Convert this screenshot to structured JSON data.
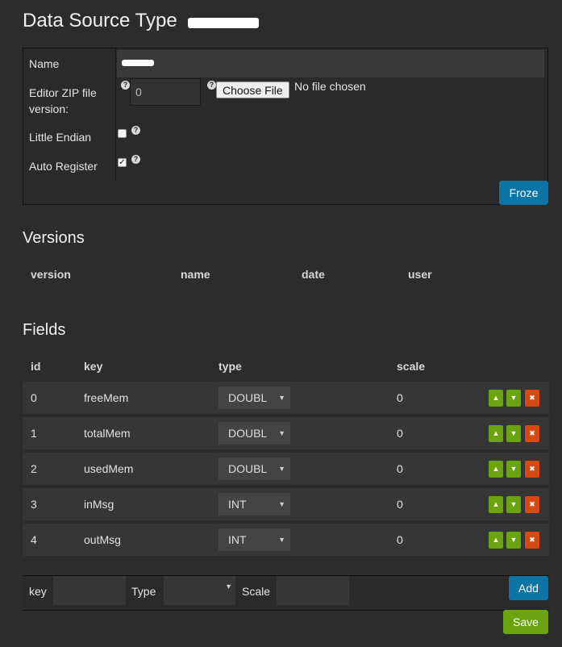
{
  "page": {
    "title": "Data Source Type"
  },
  "settings": {
    "name_label": "Name",
    "editor_zip_label_line1": "Editor ZIP file",
    "editor_zip_label_line2": "version:",
    "editor_zip_value": "0",
    "choose_file_label": "Choose File",
    "no_file_text": "No file chosen",
    "little_endian_label": "Little Endian",
    "little_endian_checked": false,
    "auto_register_label": "Auto Register",
    "auto_register_checked": true,
    "help_glyph": "?",
    "froze_label": "Froze"
  },
  "versions": {
    "heading": "Versions",
    "columns": [
      "version",
      "name",
      "date",
      "user"
    ]
  },
  "fields": {
    "heading": "Fields",
    "columns": [
      "id",
      "key",
      "type",
      "scale"
    ],
    "rows": [
      {
        "id": "0",
        "key": "freeMem",
        "type": "DOUBL",
        "scale": "0"
      },
      {
        "id": "1",
        "key": "totalMem",
        "type": "DOUBL",
        "scale": "0"
      },
      {
        "id": "2",
        "key": "usedMem",
        "type": "DOUBL",
        "scale": "0"
      },
      {
        "id": "3",
        "key": "inMsg",
        "type": "INT",
        "scale": "0"
      },
      {
        "id": "4",
        "key": "outMsg",
        "type": "INT",
        "scale": "0"
      }
    ],
    "row_action_icons": [
      "arrow-up-icon",
      "arrow-down-icon",
      "delete-icon"
    ]
  },
  "add_field": {
    "key_label": "key",
    "type_label": "Type",
    "scale_label": "Scale",
    "add_button": "Add"
  },
  "save_button": "Save",
  "colors": {
    "background": "#2c2c2c",
    "primary_blue": "#0b75a6",
    "success_green": "#6aa411",
    "danger_orange": "#d84a14"
  }
}
